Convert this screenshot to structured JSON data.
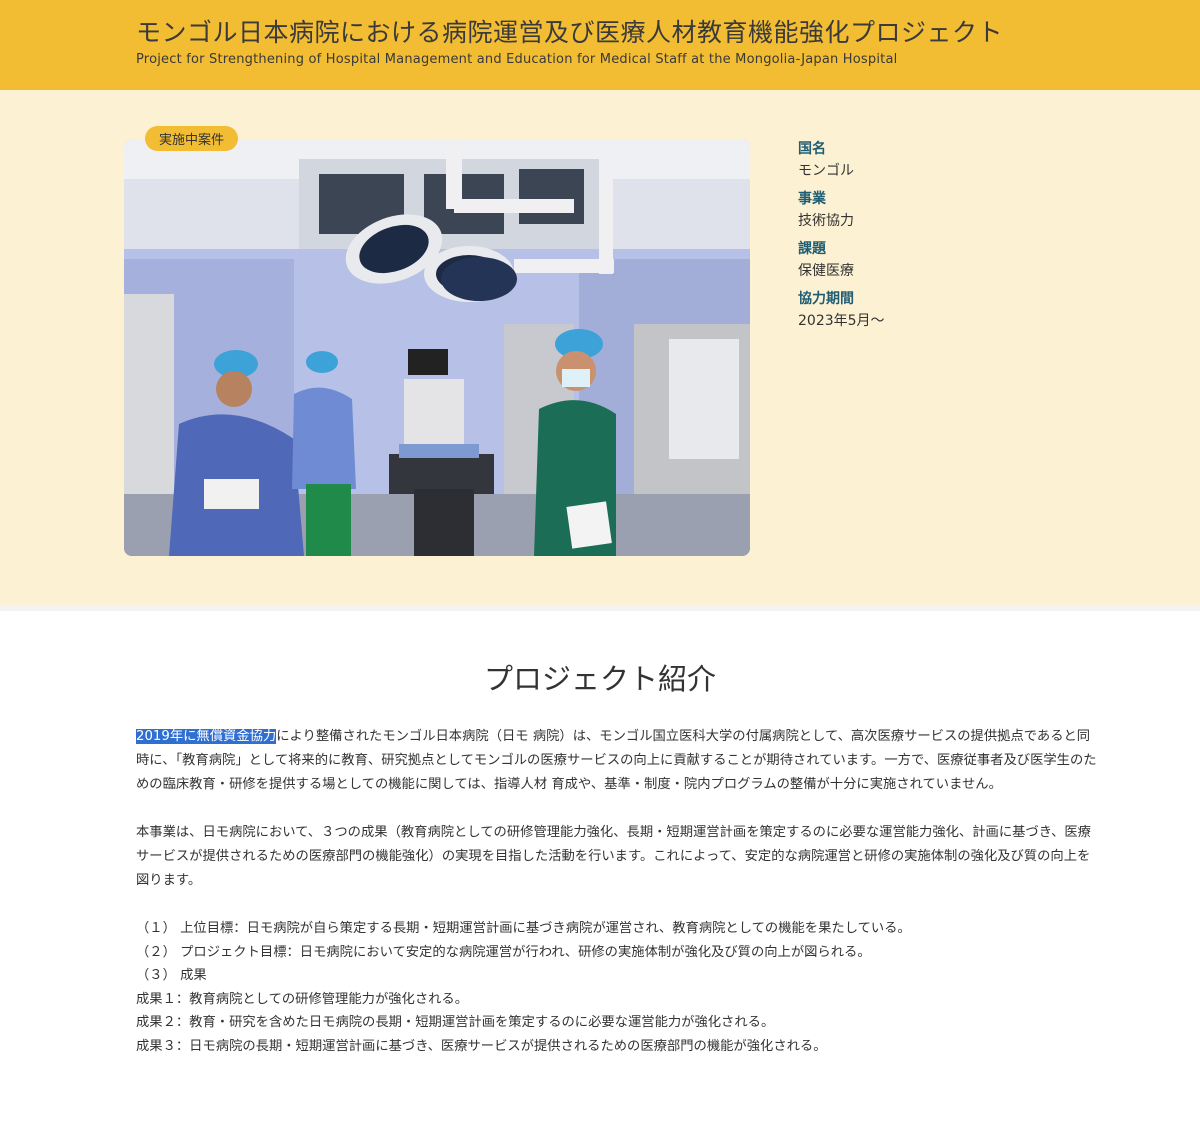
{
  "header": {
    "title": "モンゴル日本病院における病院運営及び医療人材教育機能強化プロジェクト",
    "subtitle": "Project for Strengthening of Hospital Management and Education for Medical Staff at the Mongolia-Japan Hospital"
  },
  "hero": {
    "badge": "実施中案件",
    "info": [
      {
        "term": "国名",
        "value": "モンゴル"
      },
      {
        "term": "事業",
        "value": "技術協力"
      },
      {
        "term": "課題",
        "value": "保健医療"
      },
      {
        "term": "協力期間",
        "value": "2023年5月～"
      }
    ]
  },
  "intro": {
    "heading": "プロジェクト紹介",
    "p1_highlight": "2019年に無償資金協力",
    "p1_rest": "により整備されたモンゴル日本病院（日モ 病院）は、モンゴル国立医科大学の付属病院として、高次医療サービスの提供拠点であると同時に、「教育病院」として将来的に教育、研究拠点としてモンゴルの医療サービスの向上に貢献することが期待されています。一方で、医療従事者及び医学生のための臨床教育・研修を提供する場としての機能に関しては、指導人材 育成や、基準・制度・院内プログラムの整備が十分に実施されていません。",
    "p2": "本事業は、日モ病院において、３つの成果（教育病院としての研修管理能力強化、長期・短期運営計画を策定するのに必要な運営能力強化、計画に基づき、医療サービスが提供されるための医療部門の機能強化）の実現を目指した活動を行います。これによって、安定的な病院運営と研修の実施体制の強化及び質の向上を図ります。",
    "items": [
      "（１） 上位目標：日モ病院が自ら策定する長期・短期運営計画に基づき病院が運営され、教育病院としての機能を果たしている。",
      "（２） プロジェクト目標：日モ病院において安定的な病院運営が行われ、研修の実施体制が強化及び質の向上が図られる。",
      "（３） 成果",
      "成果１：教育病院としての研修管理能力が強化される。",
      "成果２：教育・研究を含めた日モ病院の長期・短期運営計画を策定するのに必要な運営能力が強化される。",
      "成果３：日モ病院の長期・短期運営計画に基づき、医療サービスが提供されるための医療部門の機能が強化される。"
    ]
  }
}
